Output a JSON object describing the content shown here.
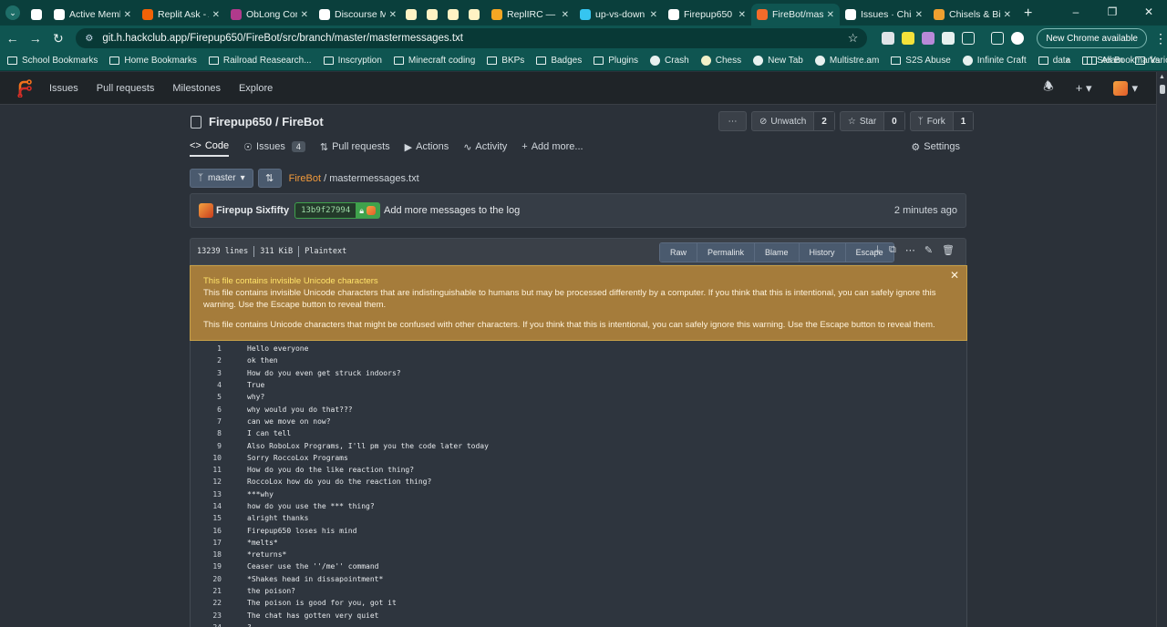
{
  "browser": {
    "tabs": [
      {
        "label": "",
        "color": "#ffffff",
        "small": true
      },
      {
        "label": "Active Membe",
        "color": "#ffffff"
      },
      {
        "label": "Replit Ask - A",
        "color": "#f26207"
      },
      {
        "label": "ObLong Comm",
        "color": "#b13a8c"
      },
      {
        "label": "Discourse Met",
        "color": "#ffffff"
      },
      {
        "label": "",
        "color": "#fff3c4",
        "small": true
      },
      {
        "label": "",
        "color": "#fff3c4",
        "small": true
      },
      {
        "label": "",
        "color": "#fff3c4",
        "small": true
      },
      {
        "label": "",
        "color": "#fff3c4",
        "small": true
      },
      {
        "label": "ReplIRC — The",
        "color": "#f5a623"
      },
      {
        "label": "up-vs-down (",
        "color": "#36c5f0"
      },
      {
        "label": "Firepup650",
        "color": "#ffffff"
      },
      {
        "label": "FireBot/maste",
        "color": "#f26b2a",
        "active": true
      },
      {
        "label": "Issues · Chisel",
        "color": "#ffffff"
      },
      {
        "label": "Chisels & Bits",
        "color": "#f0a030"
      }
    ],
    "url": "git.h.hackclub.app/Firepup650/FireBot/src/branch/master/mastermessages.txt",
    "new_chrome": "New Chrome available",
    "bookmarks": [
      "School Bookmarks",
      "Home Bookmarks",
      "Railroad Reasearch...",
      "Inscryption",
      "Minecraft coding",
      "BKPs",
      "Badges",
      "Plugins",
      "Crash",
      "Chess",
      "New Tab",
      "Multistre.am",
      "S2S Abuse",
      "Infinite Craft",
      "data",
      "Steam",
      "Various things"
    ],
    "all_bookmarks": "All Bookmarks"
  },
  "site_nav": {
    "links": [
      "Issues",
      "Pull requests",
      "Milestones",
      "Explore"
    ]
  },
  "repo": {
    "owner_name": "Firepup650 / FireBot",
    "unwatch_label": "Unwatch",
    "watch_count": "2",
    "star_label": "Star",
    "star_count": "0",
    "fork_label": "Fork",
    "fork_count": "1",
    "tabs": {
      "code": "Code",
      "issues": "Issues",
      "issues_count": "4",
      "pulls": "Pull requests",
      "actions": "Actions",
      "activity": "Activity",
      "add_more": "Add more...",
      "settings": "Settings"
    },
    "branch": "master",
    "crumb_repo": "FireBot",
    "crumb_file": "/ mastermessages.txt"
  },
  "commit": {
    "author": "Firepup Sixfifty",
    "sha": "13b9f27994",
    "message": "Add more messages to the log",
    "time": "2 minutes ago"
  },
  "file": {
    "lines": "13239 lines",
    "size": "311 KiB",
    "type": "Plaintext",
    "buttons": [
      "Raw",
      "Permalink",
      "Blame",
      "History",
      "Escape"
    ]
  },
  "warning": {
    "title": "This file contains invisible Unicode characters",
    "body1": "This file contains invisible Unicode characters that are indistinguishable to humans but may be processed differently by a computer. If you think that this is intentional, you can safely ignore this warning. Use the Escape button to reveal them.",
    "body2": "This file contains Unicode characters that might be confused with other characters. If you think that this is intentional, you can safely ignore this warning. Use the Escape button to reveal them."
  },
  "code_lines": [
    {
      "n": "1",
      "t": "Hello everyone"
    },
    {
      "n": "2",
      "t": "ok then"
    },
    {
      "n": "3",
      "t": "How do you even get struck indoors?"
    },
    {
      "n": "4",
      "t": "True"
    },
    {
      "n": "5",
      "t": "why?"
    },
    {
      "n": "6",
      "t": "why would you do that???"
    },
    {
      "n": "7",
      "t": "can we move on now?"
    },
    {
      "n": "8",
      "t": "I can tell"
    },
    {
      "n": "9",
      "t": "Also RoboLox Programs, I'll pm you the code later today"
    },
    {
      "n": "10",
      "t": "Sorry RoccoLox Programs"
    },
    {
      "n": "11",
      "t": "How do you do the like reaction thing?"
    },
    {
      "n": "12",
      "t": "RoccoLox how do you do the reaction thing?"
    },
    {
      "n": "13",
      "t": "***why"
    },
    {
      "n": "14",
      "t": "how do you use the *** thing?"
    },
    {
      "n": "15",
      "t": "alright thanks"
    },
    {
      "n": "16",
      "t": "Firepup650 loses his mind"
    },
    {
      "n": "17",
      "t": "*melts*"
    },
    {
      "n": "18",
      "t": "*returns*"
    },
    {
      "n": "19",
      "t": "Ceaser use the ''/me'' command"
    },
    {
      "n": "20",
      "t": "*Shakes head in dissapointment*"
    },
    {
      "n": "21",
      "t": "the poison?"
    },
    {
      "n": "22",
      "t": "The poison is good for you, got it"
    },
    {
      "n": "23",
      "t": "The chat has gotten very quiet"
    },
    {
      "n": "24",
      "t": "?"
    }
  ]
}
